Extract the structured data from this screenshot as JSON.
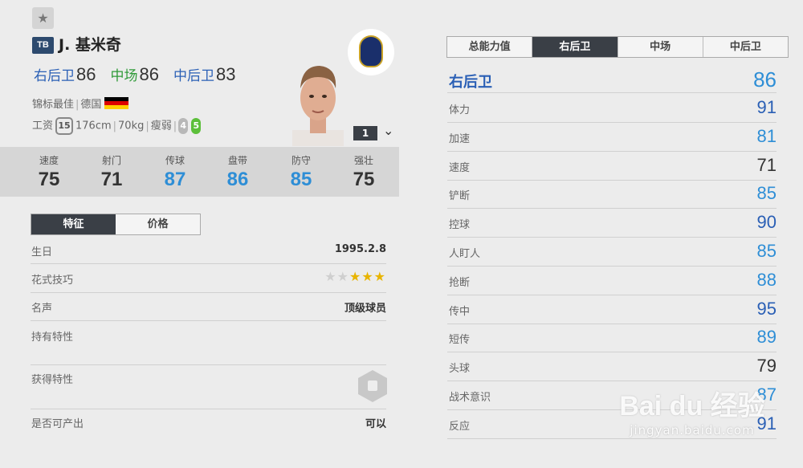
{
  "favorite_icon": "star-icon",
  "player": {
    "badge": "TB",
    "name": "J. 基米奇",
    "positions": [
      {
        "pos": "右后卫",
        "rating": "86",
        "color": "#2a5fb5"
      },
      {
        "pos": "中场",
        "rating": "86",
        "color": "#2f9a38"
      },
      {
        "pos": "中后卫",
        "rating": "83",
        "color": "#2a5fb5"
      }
    ],
    "season": "锦标最佳",
    "nation": "德国",
    "salary_label": "工资",
    "salary": "15",
    "height": "176cm",
    "weight": "70kg",
    "body": "瘦弱",
    "weak_foot": "4",
    "strong_foot": "5",
    "level": "1"
  },
  "stats": [
    {
      "label": "速度",
      "value": "75",
      "color": "#333333"
    },
    {
      "label": "射门",
      "value": "71",
      "color": "#333333"
    },
    {
      "label": "传球",
      "value": "87",
      "color": "#2e8ed6"
    },
    {
      "label": "盘带",
      "value": "86",
      "color": "#2e8ed6"
    },
    {
      "label": "防守",
      "value": "85",
      "color": "#2e8ed6"
    },
    {
      "label": "强壮",
      "value": "75",
      "color": "#333333"
    }
  ],
  "left_tabs": [
    "特征",
    "价格"
  ],
  "info": {
    "birthday_label": "生日",
    "birthday": "1995.2.8",
    "skill_label": "花式技巧",
    "skill_stars": 3,
    "skill_max": 5,
    "fame_label": "名声",
    "fame": "顶级球员",
    "traits_label": "持有特性",
    "acquired_label": "获得特性",
    "producible_label": "是否可产出",
    "producible": "可以"
  },
  "right_tabs": [
    "总能力值",
    "右后卫",
    "中场",
    "中后卫"
  ],
  "right_active": 1,
  "position_header": {
    "label": "右后卫",
    "value": "86"
  },
  "attributes": [
    {
      "label": "体力",
      "value": "91",
      "color": "#2a5fb5"
    },
    {
      "label": "加速",
      "value": "81",
      "color": "#2e8ed6"
    },
    {
      "label": "速度",
      "value": "71",
      "color": "#333333"
    },
    {
      "label": "铲断",
      "value": "85",
      "color": "#2e8ed6"
    },
    {
      "label": "控球",
      "value": "90",
      "color": "#2a5fb5"
    },
    {
      "label": "人盯人",
      "value": "85",
      "color": "#2e8ed6"
    },
    {
      "label": "抢断",
      "value": "88",
      "color": "#2e8ed6"
    },
    {
      "label": "传中",
      "value": "95",
      "color": "#2a5fb5"
    },
    {
      "label": "短传",
      "value": "89",
      "color": "#2e8ed6"
    },
    {
      "label": "头球",
      "value": "79",
      "color": "#333333"
    },
    {
      "label": "战术意识",
      "value": "87",
      "color": "#2e8ed6"
    },
    {
      "label": "反应",
      "value": "91",
      "color": "#2a5fb5"
    }
  ],
  "watermark": {
    "brand": "Bai du 经验",
    "url": "jingyan.baidu.com"
  }
}
